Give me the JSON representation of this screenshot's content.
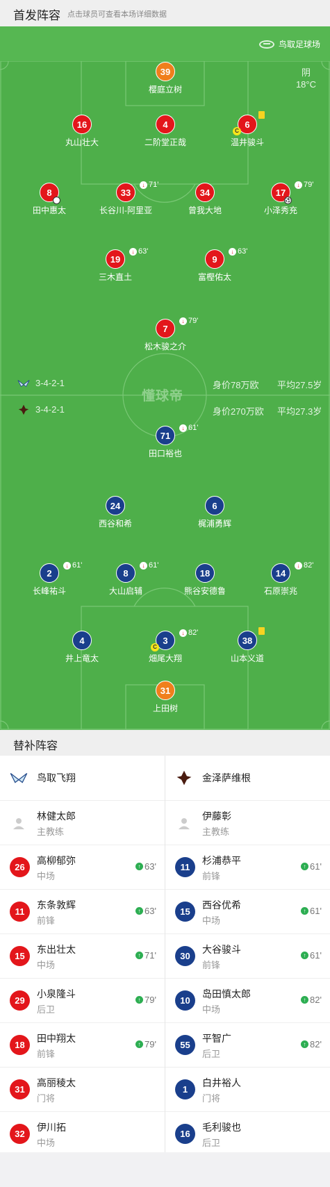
{
  "header": {
    "title": "首发阵容",
    "subtitle": "点击球员可查看本场详细数据"
  },
  "venue": {
    "name": "鸟取足球场",
    "weather": "阴",
    "temperature": "18°C"
  },
  "watermark": "懂球帝",
  "home_team": {
    "name": "鸟取飞翔",
    "formation": "3-4-2-1",
    "market_value": "身价78万欧",
    "avg_age": "平均27.5岁",
    "color": "#e3161b"
  },
  "away_team": {
    "name": "金泽萨维根",
    "formation": "3-4-2-1",
    "market_value": "身价270万欧",
    "avg_age": "平均27.3岁",
    "color": "#1a3f8c"
  },
  "home_players": [
    {
      "number": "39",
      "name": "樱庭立树",
      "role": "gk"
    },
    {
      "number": "16",
      "name": "丸山壮大"
    },
    {
      "number": "4",
      "name": "二阶堂正哉"
    },
    {
      "number": "6",
      "name": "温井骏斗",
      "yellow": true,
      "captain": "C"
    },
    {
      "number": "8",
      "name": "田中惠太",
      "assist": true
    },
    {
      "number": "33",
      "name": "长谷川-阿里亚",
      "sub": "71'"
    },
    {
      "number": "34",
      "name": "曾我大地"
    },
    {
      "number": "17",
      "name": "小泽秀充",
      "sub": "79'",
      "goal": true
    },
    {
      "number": "19",
      "name": "三木直土",
      "sub": "63'"
    },
    {
      "number": "9",
      "name": "富樫佑太",
      "sub": "63'"
    },
    {
      "number": "7",
      "name": "松木骏之介",
      "sub": "79'"
    }
  ],
  "away_players": [
    {
      "number": "71",
      "name": "田口裕也",
      "sub": "61'"
    },
    {
      "number": "24",
      "name": "西谷和希"
    },
    {
      "number": "6",
      "name": "梶浦勇辉"
    },
    {
      "number": "2",
      "name": "长峰祐斗",
      "sub": "61'"
    },
    {
      "number": "8",
      "name": "大山启辅",
      "sub": "61'"
    },
    {
      "number": "18",
      "name": "熊谷安德鲁"
    },
    {
      "number": "14",
      "name": "石原崇兆",
      "sub": "82'"
    },
    {
      "number": "4",
      "name": "井上竜太"
    },
    {
      "number": "3",
      "name": "畑尾大翔",
      "sub": "82'",
      "captain": "C"
    },
    {
      "number": "38",
      "name": "山本义道",
      "yellow": true
    },
    {
      "number": "31",
      "name": "上田树",
      "role": "gk"
    }
  ],
  "subs_title": "替补阵容",
  "home_bench": {
    "coach": {
      "name": "林健太郎",
      "role": "主教练"
    },
    "players": [
      {
        "number": "26",
        "name": "高柳郁弥",
        "position": "中场",
        "sub": "63'"
      },
      {
        "number": "11",
        "name": "东条敦辉",
        "position": "前锋",
        "sub": "63'"
      },
      {
        "number": "15",
        "name": "东出壮太",
        "position": "中场",
        "sub": "71'"
      },
      {
        "number": "29",
        "name": "小泉隆斗",
        "position": "后卫",
        "sub": "79'"
      },
      {
        "number": "18",
        "name": "田中翔太",
        "position": "前锋",
        "sub": "79'"
      },
      {
        "number": "31",
        "name": "高丽稜太",
        "position": "门将"
      },
      {
        "number": "32",
        "name": "伊川拓",
        "position": "中场"
      }
    ]
  },
  "away_bench": {
    "coach": {
      "name": "伊藤彰",
      "role": "主教练"
    },
    "players": [
      {
        "number": "11",
        "name": "杉浦恭平",
        "position": "前锋",
        "sub": "61'"
      },
      {
        "number": "15",
        "name": "西谷优希",
        "position": "中场",
        "sub": "61'"
      },
      {
        "number": "30",
        "name": "大谷骏斗",
        "position": "前锋",
        "sub": "61'"
      },
      {
        "number": "10",
        "name": "岛田慎太郎",
        "position": "中场",
        "sub": "82'"
      },
      {
        "number": "55",
        "name": "平智广",
        "position": "后卫",
        "sub": "82'"
      },
      {
        "number": "1",
        "name": "白井裕人",
        "position": "门将"
      },
      {
        "number": "16",
        "name": "毛利骏也",
        "position": "后卫"
      }
    ]
  }
}
